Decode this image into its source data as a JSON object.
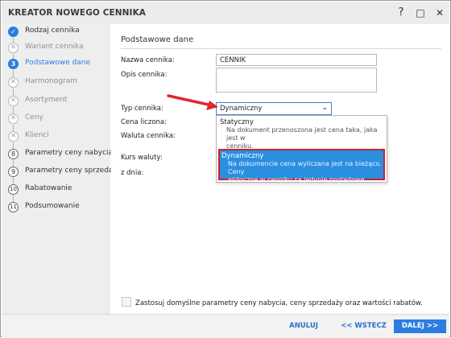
{
  "window": {
    "title": "KREATOR NOWEGO CENNIKA",
    "help_icon": "?",
    "maximize_icon": "□",
    "close_icon": "✕"
  },
  "steps": [
    {
      "label": "Rodzaj cennika",
      "state": "done",
      "marker": "✓"
    },
    {
      "label": "Wariant cennika",
      "state": "disabled",
      "marker": "✕"
    },
    {
      "label": "Podstawowe dane",
      "state": "current",
      "marker": "3"
    },
    {
      "label": "Harmonogram",
      "state": "disabled",
      "marker": "✕"
    },
    {
      "label": "Asortyment",
      "state": "disabled",
      "marker": "✕"
    },
    {
      "label": "Ceny",
      "state": "disabled",
      "marker": "✕"
    },
    {
      "label": "Klienci",
      "state": "disabled",
      "marker": "✕"
    },
    {
      "label": "Parametry ceny nabycia",
      "state": "todo",
      "marker": "8"
    },
    {
      "label": "Parametry ceny sprzedaży",
      "state": "todo",
      "marker": "9"
    },
    {
      "label": "Rabatowanie",
      "state": "todo",
      "marker": "10"
    },
    {
      "label": "Podsumowanie",
      "state": "todo",
      "marker": "11"
    }
  ],
  "form": {
    "section_title": "Podstawowe dane",
    "name_label": "Nazwa cennika:",
    "name_value": "CENNIK",
    "description_label": "Opis cennika:",
    "description_value": "",
    "type_label": "Typ cennika:",
    "type_value": "Dynamiczny",
    "price_label": "Cena liczona:",
    "currency_label": "Waluta cennika:",
    "rate_label": "Kurs waluty:",
    "date_label": "z dnia:"
  },
  "dropdown": {
    "options": [
      {
        "title": "Statyczny",
        "desc_line1": "Na dokument przenoszona jest cena taka, jaka jest w",
        "desc_line2": "cenniku.",
        "selected": false
      },
      {
        "title": "Dynamiczny",
        "desc_line1": "Na dokumencie cena wyliczana jest na bieżąco. Ceny",
        "desc_line2": "widoczne w cenniku są jedynie poglądowe.",
        "selected": true
      }
    ]
  },
  "checkbox": {
    "label": "Zastosuj domyślne parametry ceny nabycia, ceny sprzedaży oraz wartości rabatów.",
    "checked": false
  },
  "footer": {
    "cancel_label": "ANULUJ",
    "back_label": "<< WSTECZ",
    "next_label": "DALEJ >>"
  },
  "colors": {
    "accent": "#2b7de1",
    "highlight_border": "#d11e2a",
    "arrow": "#e0262f"
  }
}
